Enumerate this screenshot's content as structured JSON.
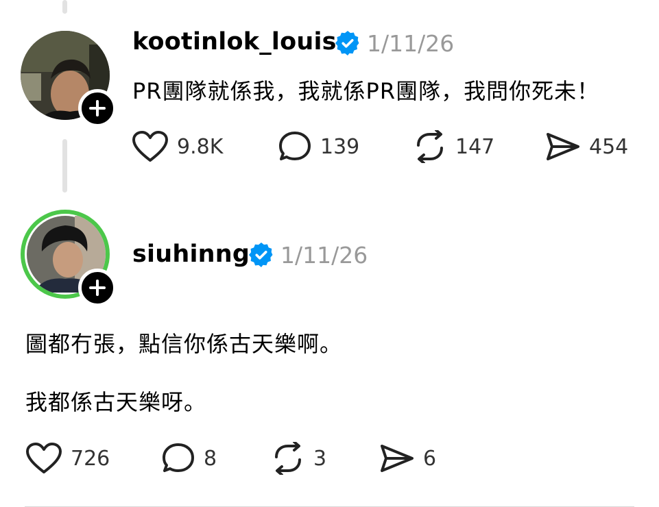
{
  "posts": [
    {
      "username": "kootinlok_louis",
      "date": "1/11/26",
      "verified": true,
      "text": "PR團隊就係我，我就係PR團隊，我問你死未！",
      "likes": "9.8K",
      "replies": "139",
      "reposts": "147",
      "shares": "454"
    },
    {
      "username": "siuhinng",
      "date": "1/11/26",
      "verified": true,
      "text_lines": [
        "圖都冇張，點信你係古天樂啊。",
        "我都係古天樂呀。"
      ],
      "likes": "726",
      "replies": "8",
      "reposts": "3",
      "shares": "6"
    }
  ],
  "colors": {
    "verified": "#0095f6",
    "meta": "#999999",
    "thread_line": "#e2e2e2",
    "story_ring": "#4cc74a"
  },
  "icons": [
    "heart-icon",
    "comment-icon",
    "repost-icon",
    "share-icon",
    "verified-badge-icon",
    "plus-icon"
  ]
}
